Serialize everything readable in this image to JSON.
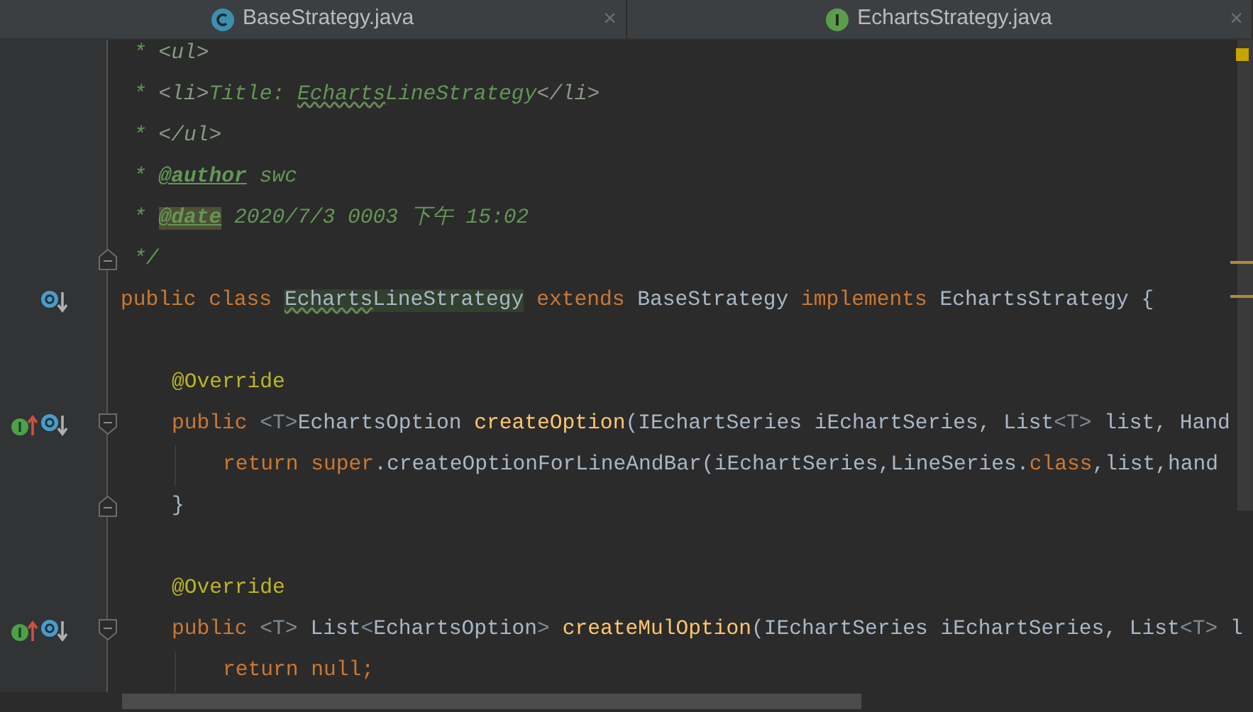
{
  "tabs": [
    {
      "label": "BaseStrategy.java",
      "kind": "class",
      "close": "×"
    },
    {
      "label": "EchartsStrategy.java",
      "kind": "interface",
      "close": "×"
    }
  ],
  "lines": [
    {
      "kind": "doc",
      "tokens": [
        {
          "kind": "comment",
          "text": "*"
        },
        {
          "kind": "markup",
          "text": " <ul>"
        }
      ]
    },
    {
      "kind": "doc",
      "tokens": [
        {
          "kind": "comment",
          "text": "*"
        },
        {
          "kind": "markup",
          "text": " <li>"
        },
        {
          "kind": "comment",
          "text": "Title: "
        },
        {
          "kind": "comment",
          "text": "Echarts",
          "typo": true
        },
        {
          "kind": "comment",
          "text": "LineStrategy"
        },
        {
          "kind": "markup",
          "text": "</li>"
        }
      ]
    },
    {
      "kind": "doc",
      "tokens": [
        {
          "kind": "comment",
          "text": "*"
        },
        {
          "kind": "markup",
          "text": " </ul>"
        }
      ]
    },
    {
      "kind": "doc",
      "tokens": [
        {
          "kind": "comment",
          "text": "* "
        },
        {
          "kind": "doc_tag",
          "text": "@author"
        },
        {
          "kind": "comment",
          "text": " swc"
        }
      ]
    },
    {
      "kind": "doc",
      "tokens": [
        {
          "kind": "comment",
          "text": "* "
        },
        {
          "kind": "doc_tag",
          "text": "@date",
          "highlighted": true
        },
        {
          "kind": "comment",
          "text": " 2020/7/3 0003 下午 15:02"
        }
      ]
    },
    {
      "kind": "doc",
      "fold_end": true,
      "tokens": [
        {
          "kind": "comment",
          "text": "*/"
        }
      ]
    },
    {
      "kind": "code",
      "gutter": [
        {
          "kind": "overridden"
        }
      ],
      "tokens": [
        {
          "kind": "keyword",
          "text": "public class"
        },
        {
          "kind": "plain",
          "text": "Echarts",
          "typo": true,
          "highlighted": true,
          "space_before": true
        },
        {
          "kind": "plain",
          "text": "LineStrategy",
          "highlighted": true
        },
        {
          "kind": "keyword",
          "text": " extends "
        },
        {
          "kind": "plain",
          "text": "BaseStrategy"
        },
        {
          "kind": "keyword",
          "text": " implements "
        },
        {
          "kind": "plain",
          "text": "EchartsStrategy {"
        }
      ],
      "children": [
        {
          "kind": "blank"
        },
        {
          "kind": "code",
          "tokens": [
            {
              "kind": "annotation",
              "text": "@Override"
            }
          ]
        },
        {
          "kind": "code",
          "fold_start": true,
          "gutter": [
            {
              "kind": "implementing"
            },
            {
              "kind": "overridden"
            }
          ],
          "tokens": [
            {
              "kind": "keyword",
              "text": "public "
            },
            {
              "kind": "type_param",
              "text": "<T>"
            },
            {
              "kind": "plain",
              "text": "EchartsOption "
            },
            {
              "kind": "method",
              "text": "createOption"
            },
            {
              "kind": "plain",
              "text": "(IEchartSeries iEchartSeries, List"
            },
            {
              "kind": "type_param",
              "text": "<T>"
            },
            {
              "kind": "plain",
              "text": " list, Hand"
            }
          ],
          "children": [
            {
              "kind": "code",
              "tokens": [
                {
                  "kind": "keyword",
                  "text": "return super"
                },
                {
                  "kind": "plain",
                  "text": ".createOptionForLineAndBar(iEchartSeries,LineSeries."
                },
                {
                  "kind": "keyword",
                  "text": "class"
                },
                {
                  "kind": "plain",
                  "text": ",list,hand"
                }
              ]
            }
          ]
        },
        {
          "kind": "code",
          "fold_end": true,
          "tokens": [
            {
              "kind": "plain",
              "text": "}"
            }
          ]
        },
        {
          "kind": "blank"
        },
        {
          "kind": "code",
          "tokens": [
            {
              "kind": "annotation",
              "text": "@Override"
            }
          ]
        },
        {
          "kind": "code",
          "fold_start": true,
          "gutter": [
            {
              "kind": "implementing"
            },
            {
              "kind": "overridden"
            }
          ],
          "tokens": [
            {
              "kind": "keyword",
              "text": "public "
            },
            {
              "kind": "type_param",
              "text": "<T>"
            },
            {
              "kind": "plain",
              "text": " List"
            },
            {
              "kind": "type_param",
              "text": "<"
            },
            {
              "kind": "plain",
              "text": "EchartsOption"
            },
            {
              "kind": "type_param",
              "text": ">"
            },
            {
              "kind": "method",
              "text": "createMulOption",
              "space_before": true
            },
            {
              "kind": "plain",
              "text": "(IEchartSeries iEchartSeries, List"
            },
            {
              "kind": "type_param",
              "text": "<T>"
            },
            {
              "kind": "plain",
              "text": " l"
            }
          ],
          "children": [
            {
              "kind": "code",
              "tokens": [
                {
                  "kind": "keyword",
                  "text": "return null;"
                }
              ]
            }
          ]
        }
      ]
    }
  ]
}
